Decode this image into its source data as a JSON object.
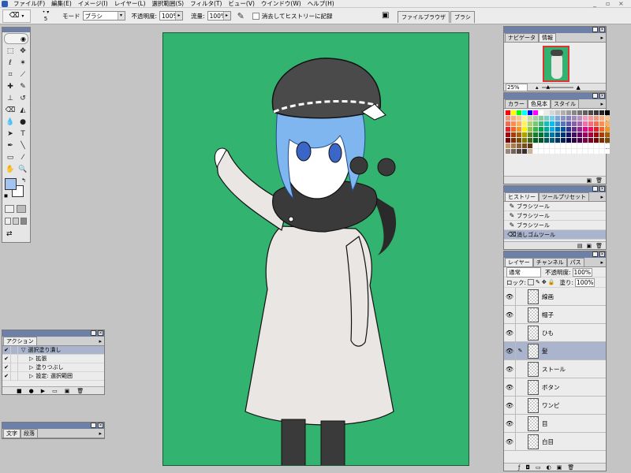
{
  "menubar": {
    "items": [
      "ファイル(F)",
      "編集(E)",
      "イメージ(I)",
      "レイヤー(L)",
      "選択範囲(S)",
      "フィルタ(T)",
      "ビュー(V)",
      "ウインドウ(W)",
      "ヘルプ(H)"
    ],
    "window_controls": [
      "_",
      "▫",
      "×"
    ]
  },
  "options_bar": {
    "brush_size": "5",
    "mode_label": "モード",
    "mode_value": "ブラシ",
    "opacity_label": "不透明度:",
    "opacity_value": "100%",
    "flow_label": "流量:",
    "flow_value": "100%",
    "erase_history_label": "消去してヒストリーに記録"
  },
  "palette_well": {
    "tabs": [
      "ファイルブラウザ",
      "ブラシ"
    ]
  },
  "navigator": {
    "tabs": [
      "ナビゲータ",
      "情報"
    ],
    "zoom": "25%"
  },
  "swatches": {
    "tabs": [
      "カラー",
      "色見本",
      "スタイル"
    ],
    "colors": [
      "#ff0000",
      "#ffff00",
      "#00ff00",
      "#00ffff",
      "#0000ff",
      "#ff00ff",
      "#ffffff",
      "#ebebeb",
      "#d7d7d7",
      "#c3c3c3",
      "#afafaf",
      "#9b9b9b",
      "#878787",
      "#737373",
      "#5f5f5f",
      "#4b4b4b",
      "#373737",
      "#232323",
      "#000000",
      "#f7977a",
      "#f9ad81",
      "#fdc68a",
      "#fff79a",
      "#c4df9b",
      "#a2d39c",
      "#82ca9d",
      "#7bcdc8",
      "#6ecff6",
      "#7ea7d8",
      "#8493ca",
      "#8882be",
      "#a187be",
      "#bc8dbf",
      "#f49ac2",
      "#f6989d",
      "#f7977a",
      "#f9ad81",
      "#fdc68a",
      "#f26c4f",
      "#f68e55",
      "#fbaf5c",
      "#fff467",
      "#acd372",
      "#7cc576",
      "#3bb878",
      "#1abbb4",
      "#00bff3",
      "#438ccb",
      "#5574b9",
      "#605ca8",
      "#855fa8",
      "#a763a8",
      "#f06ea9",
      "#f26d7d",
      "#f26c4f",
      "#f68e55",
      "#fbaf5c",
      "#ed1c24",
      "#f26522",
      "#f7941d",
      "#fff200",
      "#8dc63f",
      "#39b54a",
      "#00a651",
      "#00a99d",
      "#00aeef",
      "#0072bc",
      "#0054a6",
      "#2e3192",
      "#662d91",
      "#92278f",
      "#ec008c",
      "#ed145b",
      "#ed1c24",
      "#f26522",
      "#f7941d",
      "#9e0b0f",
      "#a0410d",
      "#a36209",
      "#aba000",
      "#598527",
      "#1a7b30",
      "#007236",
      "#00746b",
      "#0076a3",
      "#004b80",
      "#003471",
      "#1b1464",
      "#440e62",
      "#630460",
      "#9e005d",
      "#9e0039",
      "#9e0b0f",
      "#a0410d",
      "#a36209",
      "#790000",
      "#7b2e00",
      "#7d4900",
      "#827b00",
      "#406618",
      "#005e20",
      "#005826",
      "#005952",
      "#005b7f",
      "#003663",
      "#002157",
      "#0d004c",
      "#32004b",
      "#4b0049",
      "#7b0046",
      "#7a0026",
      "#790000",
      "#7b2e00",
      "#7d4900",
      "#c69c6d",
      "#a67c52",
      "#8c6239",
      "#754c24",
      "#603913",
      "#ffffff",
      "#ffffff",
      "#ffffff",
      "#ffffff",
      "#ffffff",
      "#ffffff",
      "#ffffff",
      "#ffffff",
      "#ffffff",
      "#ffffff",
      "#ffffff",
      "#ffffff",
      "#ffffff",
      "#ffffff",
      "#998675",
      "#736357",
      "#534741",
      "#362f2d",
      "#c7b299",
      "#ffffff",
      "#ffffff",
      "#ffffff",
      "#ffffff",
      "#ffffff",
      "#ffffff",
      "#ffffff",
      "#ffffff",
      "#ffffff",
      "#ffffff",
      "#ffffff",
      "#ffffff",
      "#ffffff",
      "#ffffff"
    ]
  },
  "history": {
    "tabs": [
      "ヒストリー",
      "ツールプリセット"
    ],
    "items": [
      "ブラシツール",
      "ブラシツール",
      "ブラシツール",
      "消しゴムツール"
    ]
  },
  "layers": {
    "tabs": [
      "レイヤー",
      "チャンネル",
      "パス"
    ],
    "blend_mode": "通常",
    "opacity_label": "不透明度:",
    "opacity_value": "100%",
    "lock_label": "ロック:",
    "fill_label": "塗り:",
    "fill_value": "100%",
    "items": [
      "線画",
      "帽子",
      "ひも",
      "髪",
      "ストール",
      "ボタン",
      "ワンピ",
      "目",
      "白目"
    ],
    "selected_index": 3
  },
  "actions": {
    "tabs": [
      "アクション"
    ],
    "items": [
      "選択塗り潰し",
      "拡張",
      "塗りつぶし",
      "設定: 選択範囲"
    ]
  },
  "text_panel": {
    "tabs": [
      "文字",
      "段落"
    ]
  },
  "colors": {
    "canvas_green": "#32b470",
    "foreground": "#a3c4f0",
    "panel_title": "#6d80a8",
    "selection": "#aab4cc"
  }
}
